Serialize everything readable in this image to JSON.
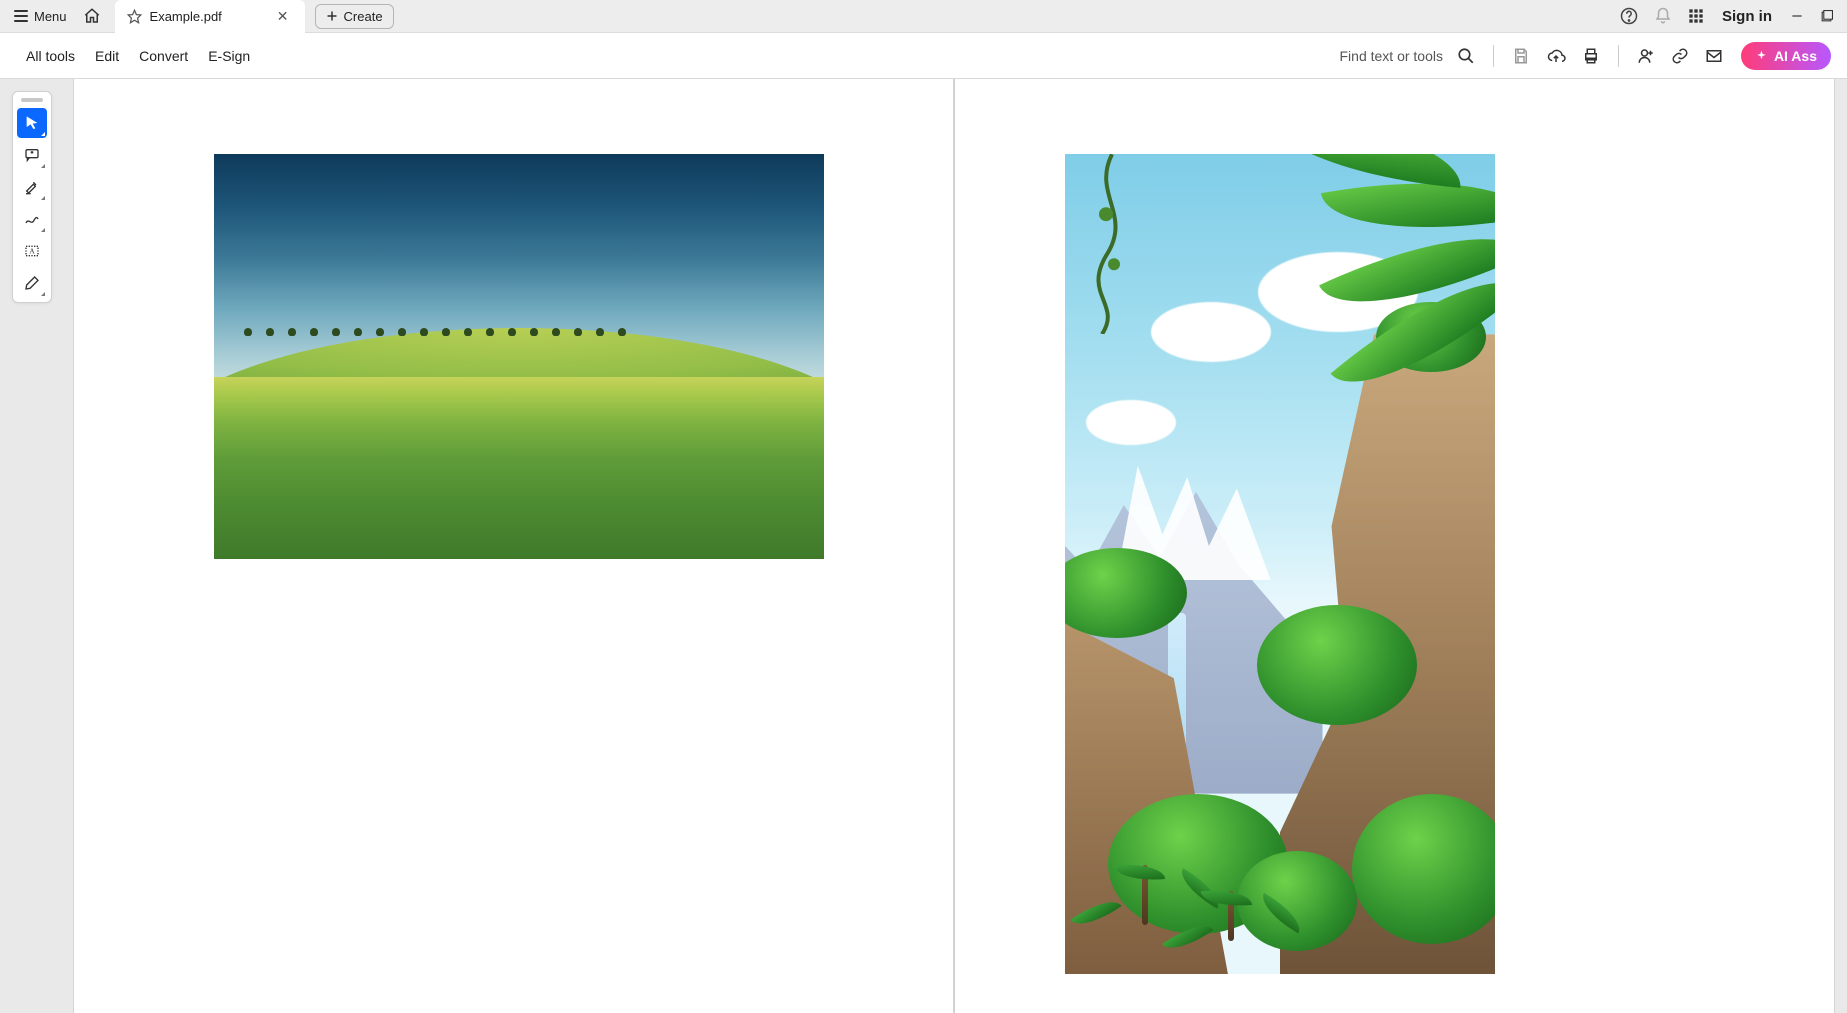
{
  "titlebar": {
    "menu_label": "Menu",
    "tab_filename": "Example.pdf",
    "create_label": "Create",
    "signin_label": "Sign in"
  },
  "toolbar": {
    "links": [
      "All tools",
      "Edit",
      "Convert",
      "E-Sign"
    ],
    "find_placeholder": "Find text or tools",
    "ai_label": "AI Ass"
  },
  "side_tools": [
    {
      "name": "select-tool",
      "active": true
    },
    {
      "name": "comment-tool",
      "active": false
    },
    {
      "name": "highlight-tool",
      "active": false
    },
    {
      "name": "draw-tool",
      "active": false
    },
    {
      "name": "text-box-tool",
      "active": false
    },
    {
      "name": "fill-sign-tool",
      "active": false
    }
  ],
  "pages": [
    {
      "content": "landscape-field-photo"
    },
    {
      "content": "tropical-jungle-illustration"
    }
  ]
}
